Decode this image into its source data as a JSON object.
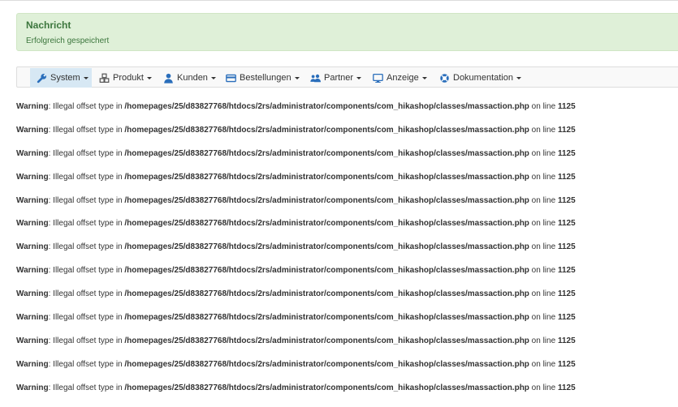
{
  "alert": {
    "heading": "Nachricht",
    "message": "Erfolgreich gespeichert",
    "color": "#3c763d",
    "background": "#dff0d8"
  },
  "menu": {
    "items": [
      {
        "label": "System",
        "icon": "wrench-icon",
        "active": true
      },
      {
        "label": "Produkt",
        "icon": "cubes-icon",
        "active": false
      },
      {
        "label": "Kunden",
        "icon": "user-icon",
        "active": false
      },
      {
        "label": "Bestellungen",
        "icon": "credit-card-icon",
        "active": false
      },
      {
        "label": "Partner",
        "icon": "group-icon",
        "active": false
      },
      {
        "label": "Anzeige",
        "icon": "monitor-icon",
        "active": false
      },
      {
        "label": "Dokumentation",
        "icon": "help-circle-icon",
        "active": false
      }
    ],
    "active_color": "#d7e8f4",
    "icon_color": "#2a6ebb"
  },
  "warnings": {
    "prefix": "Warning",
    "message": ": Illegal offset type in ",
    "path": "/homepages/25/d83827768/htdocs/2rs/administrator/components/com_hikashop/classes/massaction.php",
    "line_text": " on line ",
    "line_number": "1125",
    "count": 13
  }
}
